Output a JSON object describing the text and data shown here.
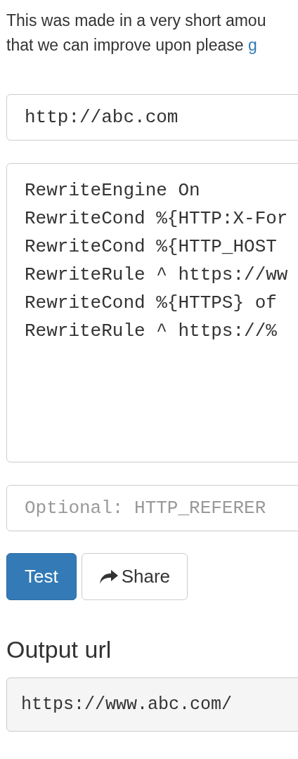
{
  "intro": {
    "line_1": "This was made in a very short amou",
    "line_2": "that we can improve upon please ",
    "link": "g"
  },
  "url_field": {
    "value": "http://abc.com"
  },
  "rules_field": {
    "lines": [
      "RewriteEngine On",
      "RewriteCond %{HTTP:X-For",
      "RewriteCond %{HTTP_HOST",
      "RewriteRule ^ https://ww",
      "RewriteCond %{HTTPS} of",
      "RewriteRule ^ https://%"
    ]
  },
  "referer_field": {
    "placeholder": "Optional: HTTP_REFERER"
  },
  "buttons": [
    {
      "kind": "primary",
      "label": "Test"
    },
    {
      "kind": "share",
      "label": "Share"
    }
  ],
  "output": {
    "heading": "Output url",
    "value": "https://www.abc.com/"
  }
}
